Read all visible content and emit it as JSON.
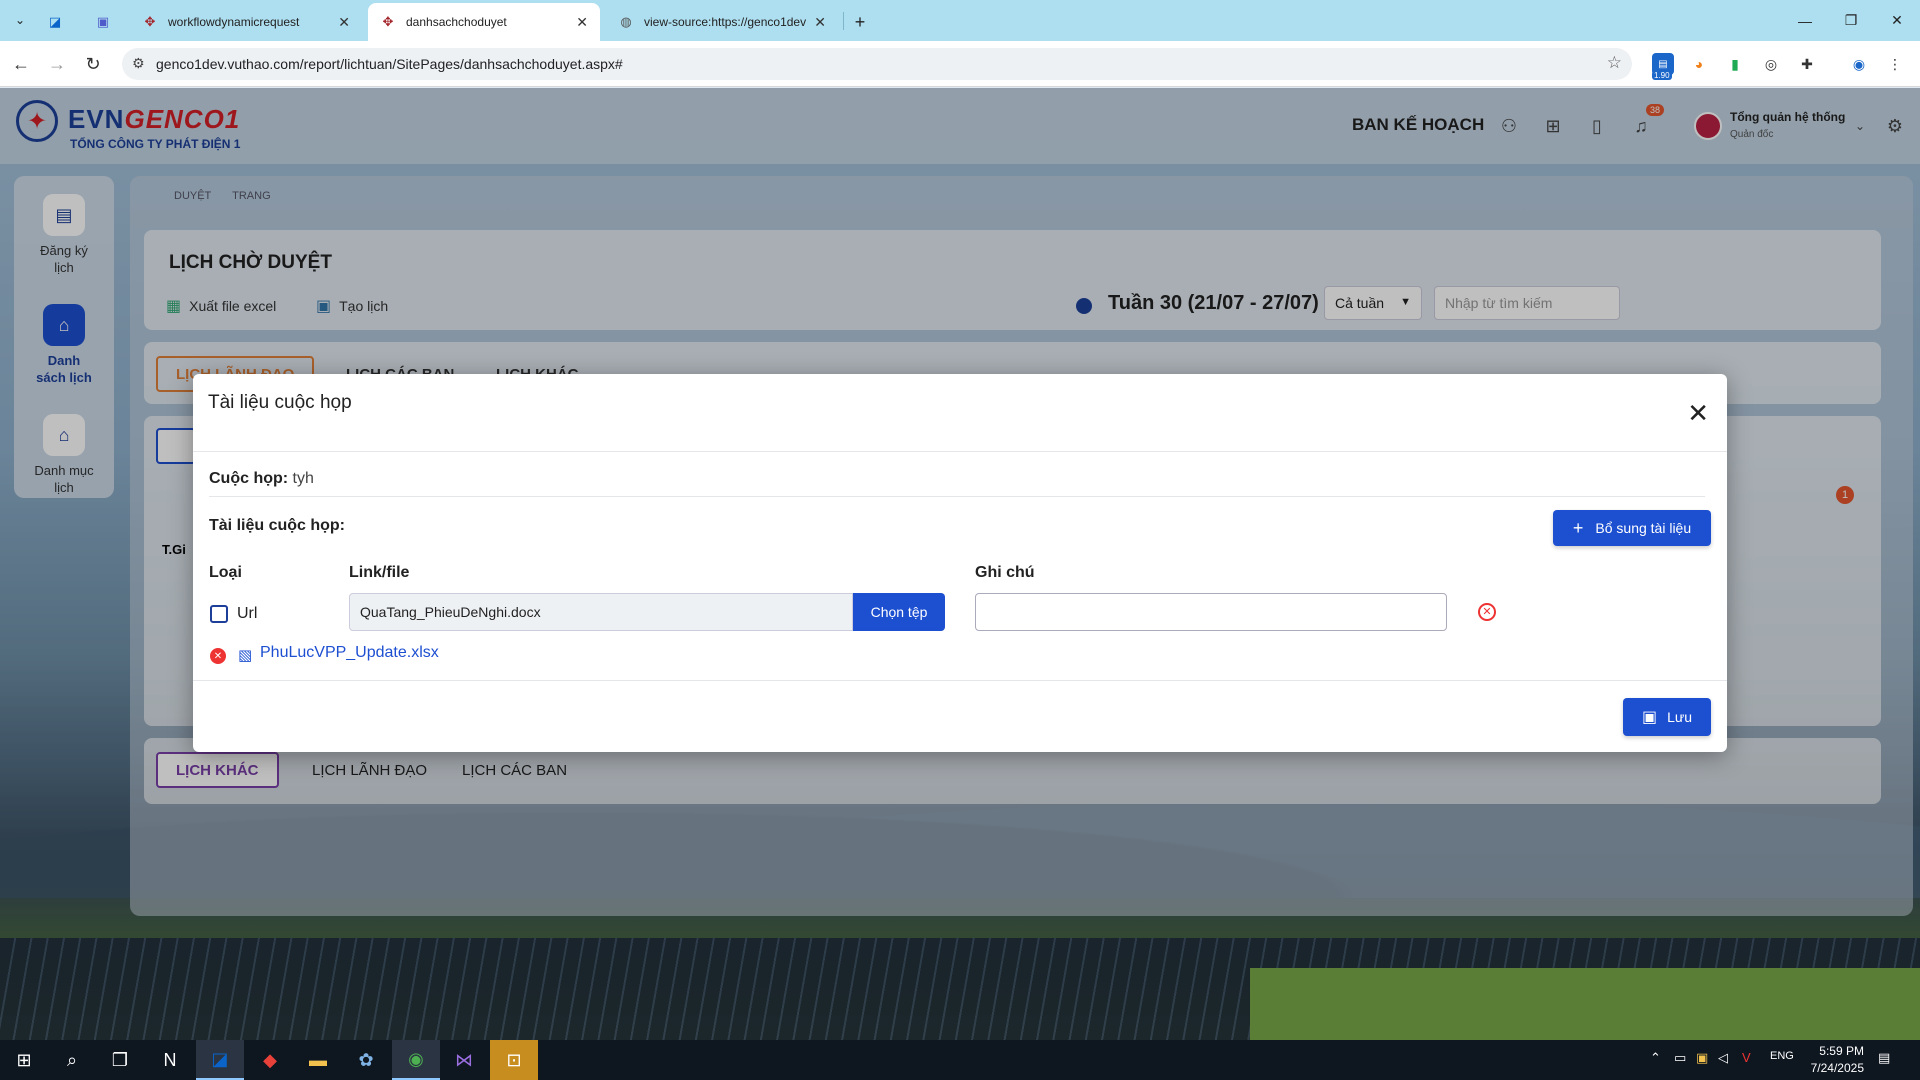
{
  "browser": {
    "tabs": [
      {
        "title": "",
        "icon": "outlook-icon"
      },
      {
        "title": "",
        "icon": "teams-icon"
      },
      {
        "title": "workflowdynamicrequest",
        "icon": "sharepoint-icon"
      },
      {
        "title": "danhsachchoduyet",
        "icon": "sharepoint-icon"
      },
      {
        "title": "view-source:https://genco1dev",
        "icon": "globe-icon"
      }
    ],
    "new_tab": "+",
    "url": "genco1dev.vuthao.com/report/lichtuan/SitePages/danhsachchoduyet.aspx#",
    "ext_badge": "1.90"
  },
  "header": {
    "brand": "EVN",
    "brand_accent": "GENCO1",
    "subtitle": "TỔNG CÔNG TY PHÁT ĐIỆN 1",
    "department": "BAN KẾ HOẠCH",
    "notification_count": "38",
    "user_name": "Tổng quản hệ thống",
    "user_role": "Quản đốc"
  },
  "sidebar": {
    "items": [
      {
        "label": "Đăng ký lịch",
        "icon": "document-icon"
      },
      {
        "label": "Danh sách lịch",
        "icon": "home-icon"
      },
      {
        "label": "Danh mục lịch",
        "icon": "home-icon"
      }
    ]
  },
  "breadcrumb": [
    "DUYỆT",
    "TRANG"
  ],
  "main": {
    "title": "LỊCH CHỜ DUYỆT",
    "export_label": "Xuất file excel",
    "create_label": "Tạo lịch",
    "week_label": "Tuần 30 (21/07 - 27/07)",
    "filter_value": "Cả tuần",
    "search_placeholder": "Nhập từ tìm kiếm",
    "top_tabs": [
      "LỊCH LÃNH ĐẠO",
      "LỊCH CÁC BAN",
      "LỊCH KHÁC"
    ],
    "bottom_tabs": [
      "LỊCH KHÁC",
      "LỊCH LÃNH ĐẠO",
      "LỊCH CÁC BAN"
    ],
    "partial_row_label": "T.Gi",
    "count_badge": "1"
  },
  "modal": {
    "title": "Tài liệu cuộc họp",
    "meeting_label": "Cuộc họp:",
    "meeting_value": "tyh",
    "docs_label": "Tài liệu cuộc họp:",
    "add_button": "Bổ sung tài liệu",
    "columns": {
      "type": "Loại",
      "link": "Link/file",
      "note": "Ghi chú"
    },
    "url_checkbox_label": "Url",
    "file_value": "QuaTang_PhieuDeNghi.docx",
    "choose_file_button": "Chọn tệp",
    "note_value": "",
    "attached_file": "PhuLucVPP_Update.xlsx",
    "save_button": "Lưu"
  },
  "taskbar": {
    "time": "5:59 PM",
    "date": "7/24/2025",
    "lang": "ENG"
  },
  "colors": {
    "primary": "#1d4fd1",
    "brand_blue": "#1d3f9a",
    "brand_red": "#d31f27",
    "tab_active_purple": "#7a3fa8",
    "danger": "#e33"
  }
}
